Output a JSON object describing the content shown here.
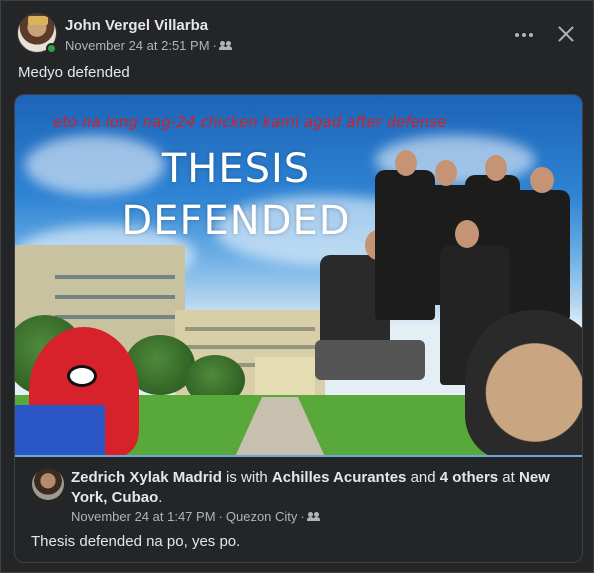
{
  "post": {
    "author": "John Vergel Villarba",
    "timestamp": "November 24 at 2:51 PM",
    "separator": " · ",
    "audience_icon": "friends-icon",
    "text": "Medyo defended",
    "actions": {
      "more": "more-options-icon",
      "close": "close-icon"
    }
  },
  "shared_post": {
    "photo": {
      "caption_overlay": "eto na long nag-24 chicken kami agad after defense",
      "title_line1": "THESIS",
      "title_line2": "DEFENDED"
    },
    "author": "Zedrich Xylak Madrid",
    "with_text": " is with ",
    "tagged": "Achilles Acurantes",
    "and_text": " and ",
    "others": "4 others",
    "at_text": " at ",
    "location": "New York, Cubao",
    "period": ".",
    "timestamp": "November 24 at 1:47 PM",
    "separator": " · ",
    "place": "Quezon City",
    "separator2": " · ",
    "text": "Thesis defended na po, yes po."
  },
  "colors": {
    "background": "#242526",
    "primary_text": "#e4e6eb",
    "secondary_text": "#b0b3b8",
    "online": "#31a24c",
    "overlay_red": "#d42020"
  }
}
